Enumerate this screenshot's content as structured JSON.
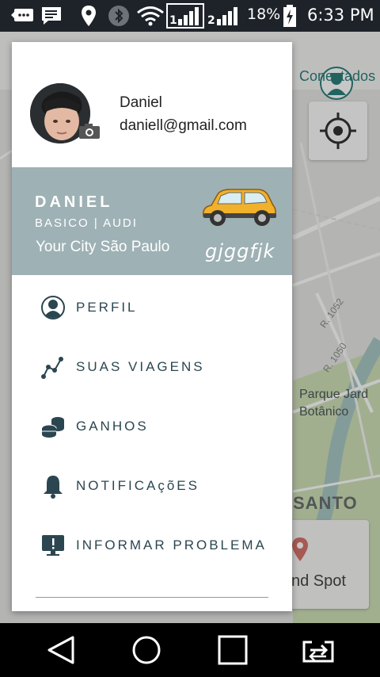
{
  "status_bar": {
    "battery_percent": "18%",
    "time": "6:33 PM",
    "icons": [
      "notification-icon",
      "message-icon",
      "location-icon",
      "bluetooth-icon",
      "wifi-icon",
      "signal-1-icon",
      "signal-2-icon",
      "battery-charging-icon"
    ]
  },
  "map": {
    "status_label": "Conectados",
    "park_label_line1": "Parque Jard",
    "park_label_line2": "Botânico",
    "district_label": "SANTO",
    "spot_label": "nd Spot",
    "street_1": "R. 1052",
    "street_2": "R. 1050"
  },
  "drawer": {
    "user": {
      "name": "Daniel",
      "email": "daniell@gmail.com"
    },
    "driver": {
      "name": "DANIEL",
      "plan": "BASICO | AUDI",
      "city": "Your City São Paulo",
      "plate": "gjggfjk"
    },
    "menu": [
      {
        "label": "PERFIL",
        "icon": "person-icon"
      },
      {
        "label": "SUAS VIAGENS",
        "icon": "route-icon"
      },
      {
        "label": "GANHOS",
        "icon": "coins-icon"
      },
      {
        "label": "NOTIFICAçõES",
        "icon": "bell-icon"
      },
      {
        "label": "INFORMAR PROBLEMA",
        "icon": "monitor-alert-icon"
      }
    ]
  },
  "nav_bar": {
    "buttons": [
      "back-icon",
      "home-icon",
      "recents-icon",
      "switch-apps-icon"
    ]
  },
  "colors": {
    "status_bar": "#1e232a",
    "driver_card": "#9eb1b5",
    "menu_text": "#2b4650",
    "accent": "#2e7f7a",
    "car": "#f2b12a"
  }
}
